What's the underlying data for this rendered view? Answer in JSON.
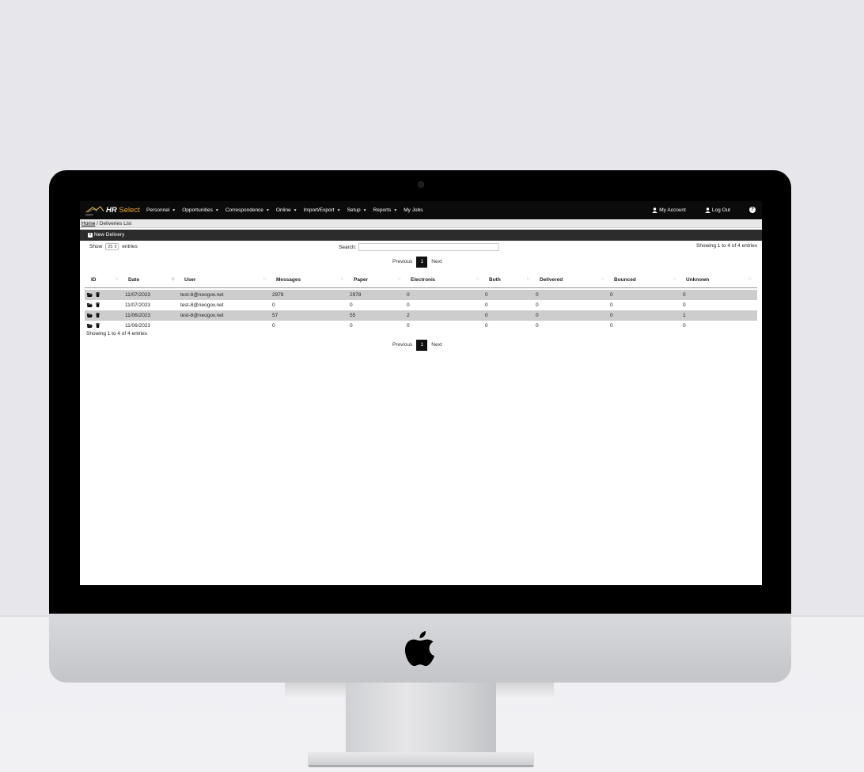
{
  "app": {
    "brand_prefix": "HR",
    "brand_suffix": "Select",
    "logo": "neogov-logo"
  },
  "nav": {
    "items": [
      {
        "label": "Personnel",
        "dropdown": true
      },
      {
        "label": "Opportunities",
        "dropdown": true
      },
      {
        "label": "Correspondence",
        "dropdown": true
      },
      {
        "label": "Online",
        "dropdown": true
      },
      {
        "label": "Import/Export",
        "dropdown": true
      },
      {
        "label": "Setup",
        "dropdown": true
      },
      {
        "label": "Reports",
        "dropdown": true
      },
      {
        "label": "My Jobs",
        "dropdown": false
      }
    ],
    "my_account": "My Account",
    "log_out": "Log Out",
    "help": "?"
  },
  "breadcrumb": {
    "home": "Home",
    "separator": " / ",
    "current": "Deliveries List"
  },
  "actions": {
    "new_delivery": "New Delivery"
  },
  "controls": {
    "show_label": "Show",
    "entries_value": "25",
    "entries_label": "entries",
    "search_label": "Search:",
    "search_value": "",
    "info": "Showing 1 to 4 of 4 entries"
  },
  "pagination": {
    "previous": "Previous",
    "current": "1",
    "next": "Next"
  },
  "table": {
    "headers": [
      "ID",
      "Date",
      "User",
      "Messages",
      "Paper",
      "Electronic",
      "Both",
      "Delivered",
      "Bounced",
      "Unknown"
    ],
    "rows": [
      {
        "date": "11/07/2023",
        "user": "test-8@neogov.net",
        "messages": "2978",
        "paper": "2978",
        "electronic": "0",
        "both": "0",
        "delivered": "0",
        "bounced": "0",
        "unknown": "0"
      },
      {
        "date": "11/07/2023",
        "user": "test-8@neogov.net",
        "messages": "0",
        "paper": "0",
        "electronic": "0",
        "both": "0",
        "delivered": "0",
        "bounced": "0",
        "unknown": "0"
      },
      {
        "date": "11/06/2023",
        "user": "test-8@neogov.net",
        "messages": "57",
        "paper": "55",
        "electronic": "2",
        "both": "0",
        "delivered": "0",
        "bounced": "0",
        "unknown": "1"
      },
      {
        "date": "11/06/2023",
        "user": "",
        "messages": "0",
        "paper": "0",
        "electronic": "0",
        "both": "0",
        "delivered": "0",
        "bounced": "0",
        "unknown": "0"
      }
    ]
  },
  "colors": {
    "navbar": "#0b0b0b",
    "brand_accent": "#f0a928",
    "action_bar": "#2c2c2c",
    "row_alt": "#cdcdcd"
  }
}
